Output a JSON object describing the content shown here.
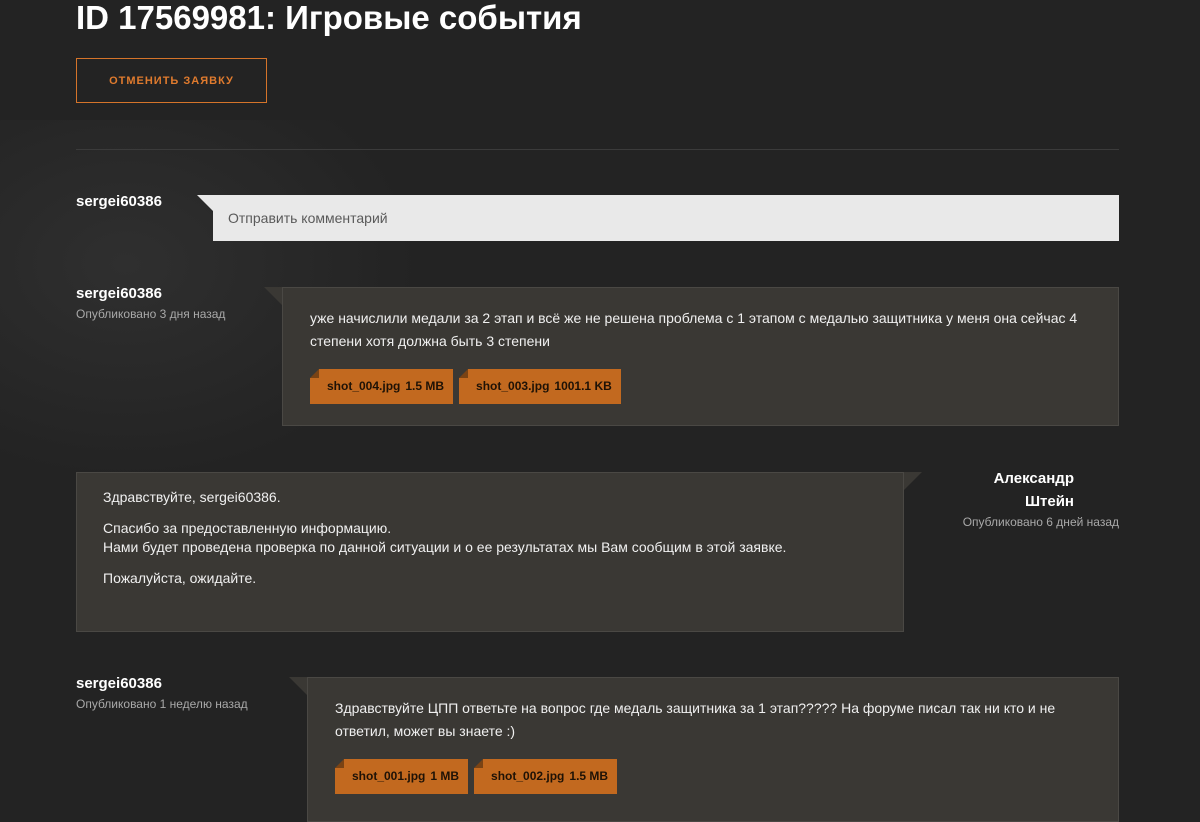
{
  "ticket": {
    "title": "ID 17569981: Игровые события",
    "cancel_label": "Отменить заявку"
  },
  "composer": {
    "author": "sergei60386",
    "placeholder": "Отправить комментарий"
  },
  "messages": [
    {
      "author": "sergei60386",
      "published": "Опубликовано 3 дня назад",
      "text": "уже начислили медали за 2 этап и всё же не решена проблема с 1 этапом с медалью защитника у меня она сейчас 4 степени хотя должна быть 3 степени",
      "attachments": [
        {
          "name": "shot_004.jpg",
          "size": "1.5 MB"
        },
        {
          "name": "shot_003.jpg",
          "size": "1001.1 KB"
        }
      ]
    },
    {
      "author_line1": "Александр",
      "author_line2": "Штейн",
      "published": "Опубликовано 6 дней назад",
      "paragraphs": [
        "Здравствуйте, sergei60386.",
        "Спасибо за предоставленную информацию.",
        "Нами будет проведена проверка по данной ситуации и о ее результатах мы Вам сообщим в этой заявке.",
        "Пожалуйста, ожидайте."
      ]
    },
    {
      "author": "sergei60386",
      "published": "Опубликовано 1 неделю назад",
      "text": "Здравствуйте ЦПП ответьте на вопрос где медаль защитника за 1 этап????? На форуме писал так ни кто и не ответил, может вы знаете :)",
      "attachments": [
        {
          "name": "shot_001.jpg",
          "size": "1 MB"
        },
        {
          "name": "shot_002.jpg",
          "size": "1.5 MB"
        }
      ]
    }
  ],
  "colors": {
    "background": "#232323",
    "accent": "#d5742a",
    "attachment": "#c2691f",
    "bubble": "#3a3834",
    "input": "#e9e9e9"
  }
}
